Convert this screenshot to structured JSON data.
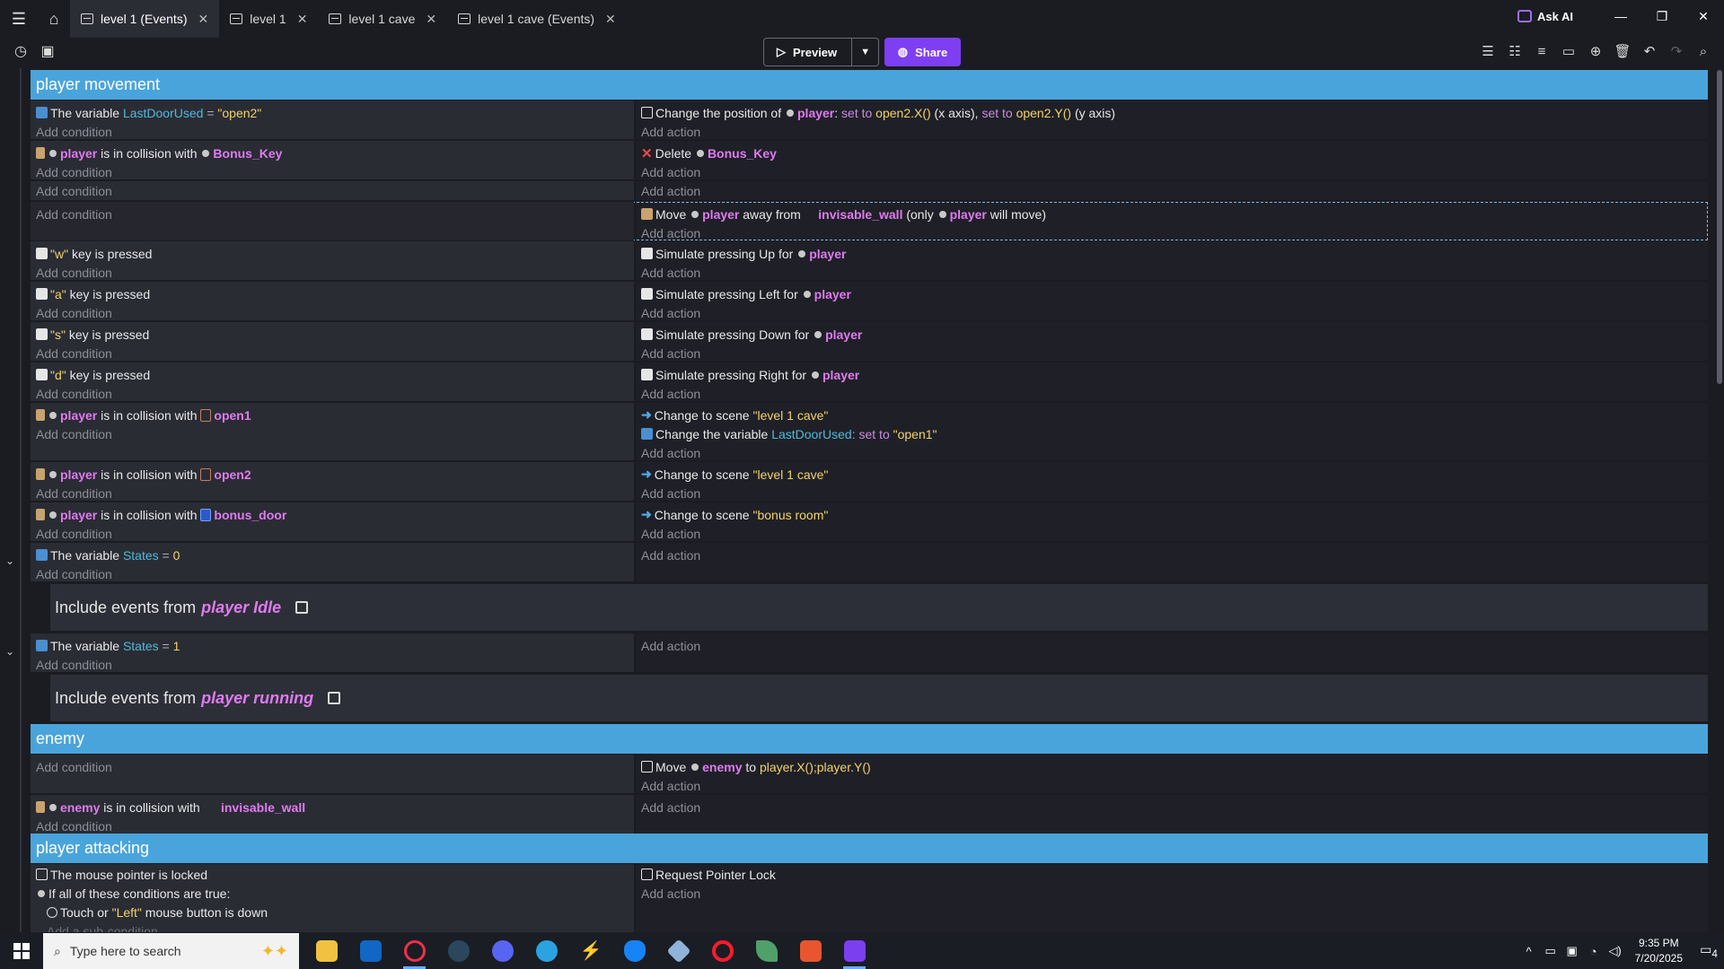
{
  "window": {
    "tabs": [
      {
        "label": "level 1 (Events)",
        "active": true,
        "icon": "events-icon"
      },
      {
        "label": "level 1",
        "active": false,
        "icon": "scene-icon"
      },
      {
        "label": "level 1 cave",
        "active": false,
        "icon": "scene-icon"
      },
      {
        "label": "level 1 cave (Events)",
        "active": false,
        "icon": "events-icon"
      }
    ],
    "ask_ai": "Ask AI"
  },
  "toolbar": {
    "preview_label": "Preview",
    "share_label": "Share"
  },
  "groups": {
    "player_movement": "player movement",
    "enemy": "enemy",
    "player_attacking": "player attacking"
  },
  "common": {
    "add_condition": "Add condition",
    "add_action": "Add action",
    "add_sub_condition": "Add a sub-condition",
    "include_prefix": "Include events from"
  },
  "events": {
    "e1": {
      "cond": {
        "pre": "The variable",
        "var": "LastDoorUsed",
        "op": "=",
        "val": "\"open2\""
      },
      "act": {
        "pre": "Change the position of",
        "obj": "player",
        "mid1": "set to",
        "v1": "open2.X()",
        "mid2": "(x axis),",
        "mid3": "set to",
        "v2": "open2.Y()",
        "post": "(y axis)"
      }
    },
    "e2": {
      "cond": {
        "obj": "player",
        "mid": "is in collision with",
        "obj2": "Bonus_Key"
      },
      "act": {
        "pre": "Delete",
        "obj": "Bonus_Key"
      }
    },
    "e4": {
      "act": {
        "pre": "Move",
        "obj": "player",
        "mid": "away from",
        "obj2": "invisable_wall",
        "post1": "(only",
        "obj3": "player",
        "post2": "will move)"
      }
    },
    "keys": [
      {
        "key": "\"w\"",
        "suffix": "key is pressed",
        "action": "Simulate pressing Up for",
        "obj": "player"
      },
      {
        "key": "\"a\"",
        "suffix": "key is pressed",
        "action": "Simulate pressing Left for",
        "obj": "player"
      },
      {
        "key": "\"s\"",
        "suffix": "key is pressed",
        "action": "Simulate pressing Down for",
        "obj": "player"
      },
      {
        "key": "\"d\"",
        "suffix": "key is pressed",
        "action": "Simulate pressing Right for",
        "obj": "player"
      }
    ],
    "open1": {
      "cond": {
        "obj": "player",
        "mid": "is in collision with",
        "obj2": "open1"
      },
      "act1": {
        "pre": "Change to scene",
        "val": "\"level 1 cave\""
      },
      "act2": {
        "pre": "Change the variable",
        "var": "LastDoorUsed",
        "mid": ": set to",
        "val": "\"open1\""
      }
    },
    "open2": {
      "cond": {
        "obj": "player",
        "mid": "is in collision with",
        "obj2": "open2"
      },
      "act": {
        "pre": "Change to scene",
        "val": "\"level 1 cave\""
      }
    },
    "bonus": {
      "cond": {
        "obj": "player",
        "mid": "is in collision with",
        "obj2": "bonus_door"
      },
      "act": {
        "pre": "Change to scene",
        "val": "\"bonus room\""
      }
    },
    "states0": {
      "cond": {
        "pre": "The variable",
        "var": "States",
        "op": "=",
        "val": "0"
      },
      "include": "player Idle"
    },
    "states1": {
      "cond": {
        "pre": "The variable",
        "var": "States",
        "op": "=",
        "val": "1"
      },
      "include": "player running"
    },
    "enemy_move": {
      "act": {
        "pre": "Move",
        "obj": "enemy",
        "mid": "to",
        "val": "player.X();player.Y()"
      }
    },
    "enemy_coll": {
      "cond": {
        "obj": "enemy",
        "mid": "is in collision with",
        "obj2": "invisable_wall"
      }
    },
    "attack": {
      "cond1": "The mouse pointer is locked",
      "cond2": "If all of these conditions are true:",
      "cond3_pre": "Touch or",
      "cond3_val": "\"Left\"",
      "cond3_post": "mouse button is down",
      "act": "Request Pointer Lock"
    }
  },
  "taskbar": {
    "search_placeholder": "Type here to search",
    "time": "9:35 PM",
    "date": "7/20/2025",
    "notif_count": "4"
  }
}
